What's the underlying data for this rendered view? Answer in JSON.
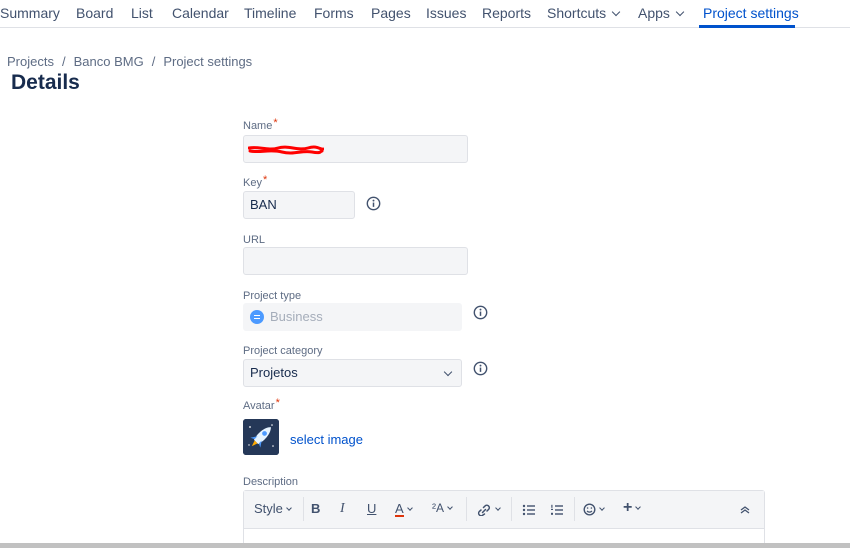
{
  "nav": {
    "items": [
      "Summary",
      "Board",
      "List",
      "Calendar",
      "Timeline",
      "Forms",
      "Pages",
      "Issues",
      "Reports"
    ],
    "shortcuts": "Shortcuts",
    "apps": "Apps",
    "active": "Project settings"
  },
  "breadcrumb": [
    "Projects",
    "Banco BMG",
    "Project settings"
  ],
  "page_title": "Details",
  "form": {
    "name_label": "Name",
    "required_mark": "*",
    "key_label": "Key",
    "key_value": "BAN",
    "url_label": "URL",
    "url_value": "",
    "type_label": "Project type",
    "type_value": "Business",
    "category_label": "Project category",
    "category_value": "Projetos",
    "avatar_label": "Avatar",
    "select_image": "select image",
    "description_label": "Description"
  },
  "editor": {
    "style_label": "Style",
    "bold": "B",
    "italic": "I",
    "underline": "U",
    "text_color": "A",
    "more_format": "²A"
  },
  "colors": {
    "accent": "#0052cc",
    "required": "#de350b",
    "redaction": "#ff0000"
  }
}
